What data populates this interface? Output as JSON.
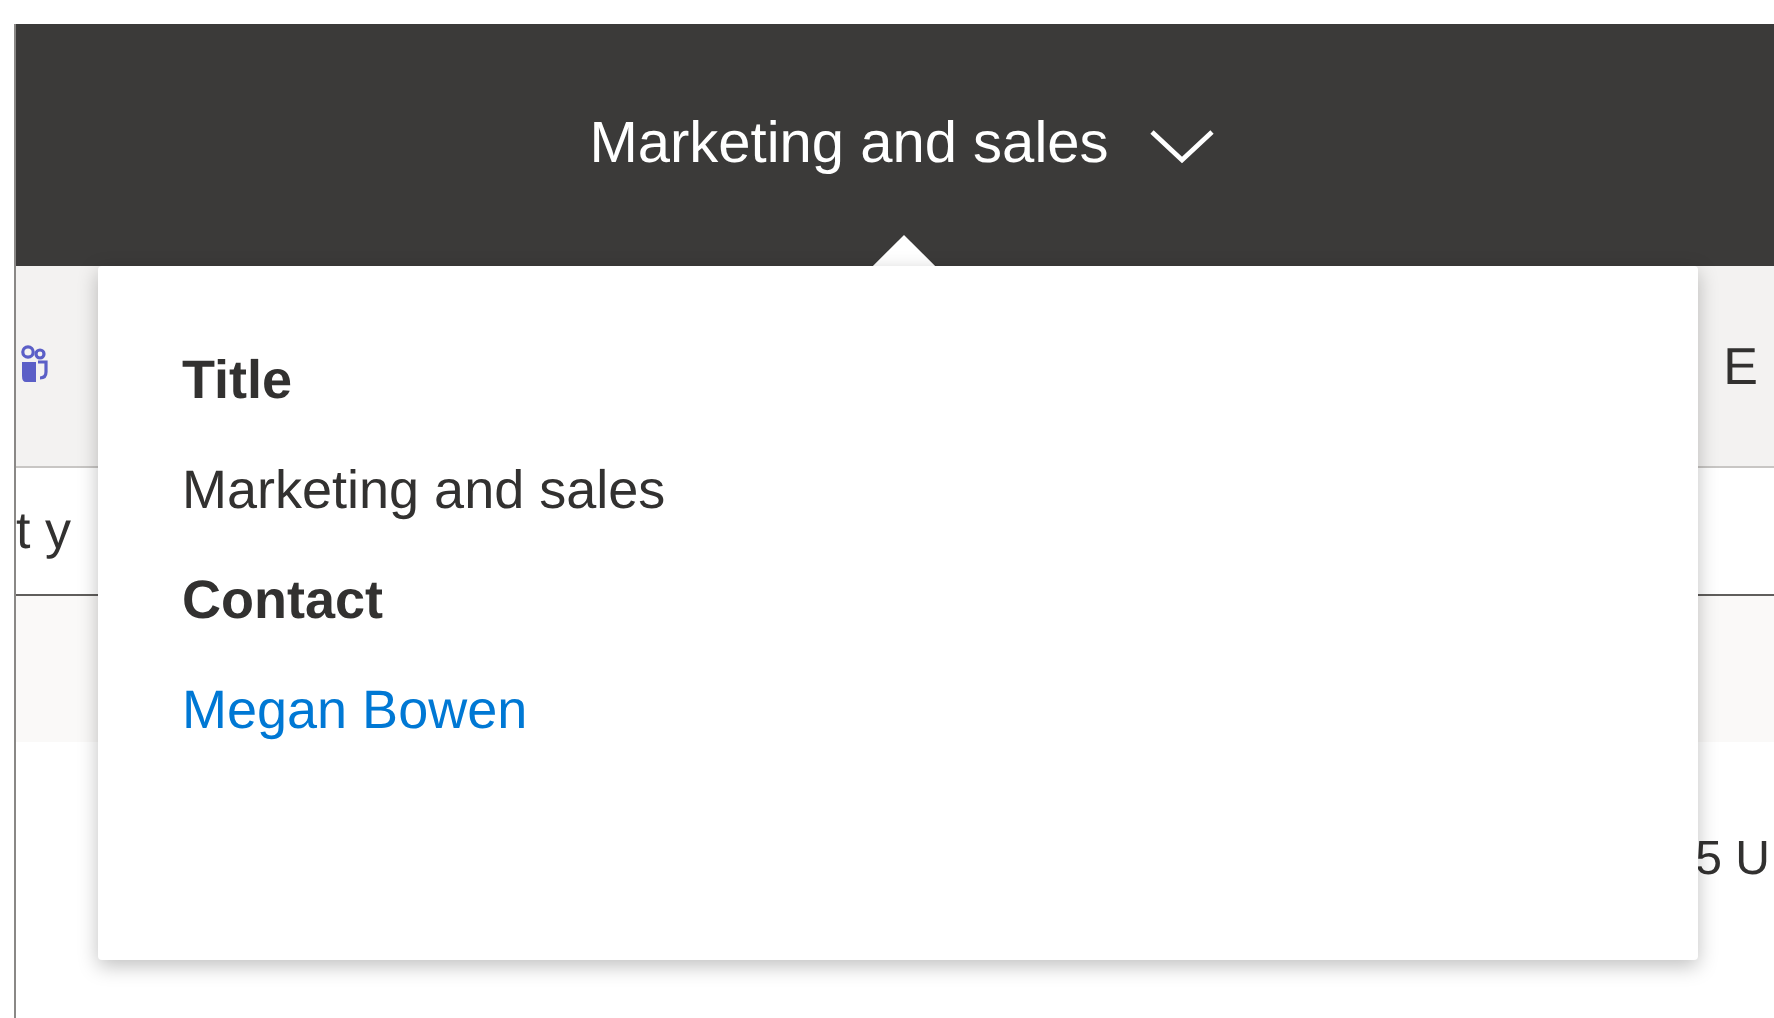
{
  "header": {
    "title": "Marketing and sales"
  },
  "toolbar": {
    "right_text": "E"
  },
  "search": {
    "value": "t y"
  },
  "content": {
    "text": "5 U"
  },
  "popup": {
    "fields": [
      {
        "label": "Title",
        "value": "Marketing and sales",
        "kind": "text"
      },
      {
        "label": "Contact",
        "value": "Megan Bowen",
        "kind": "link"
      }
    ]
  }
}
